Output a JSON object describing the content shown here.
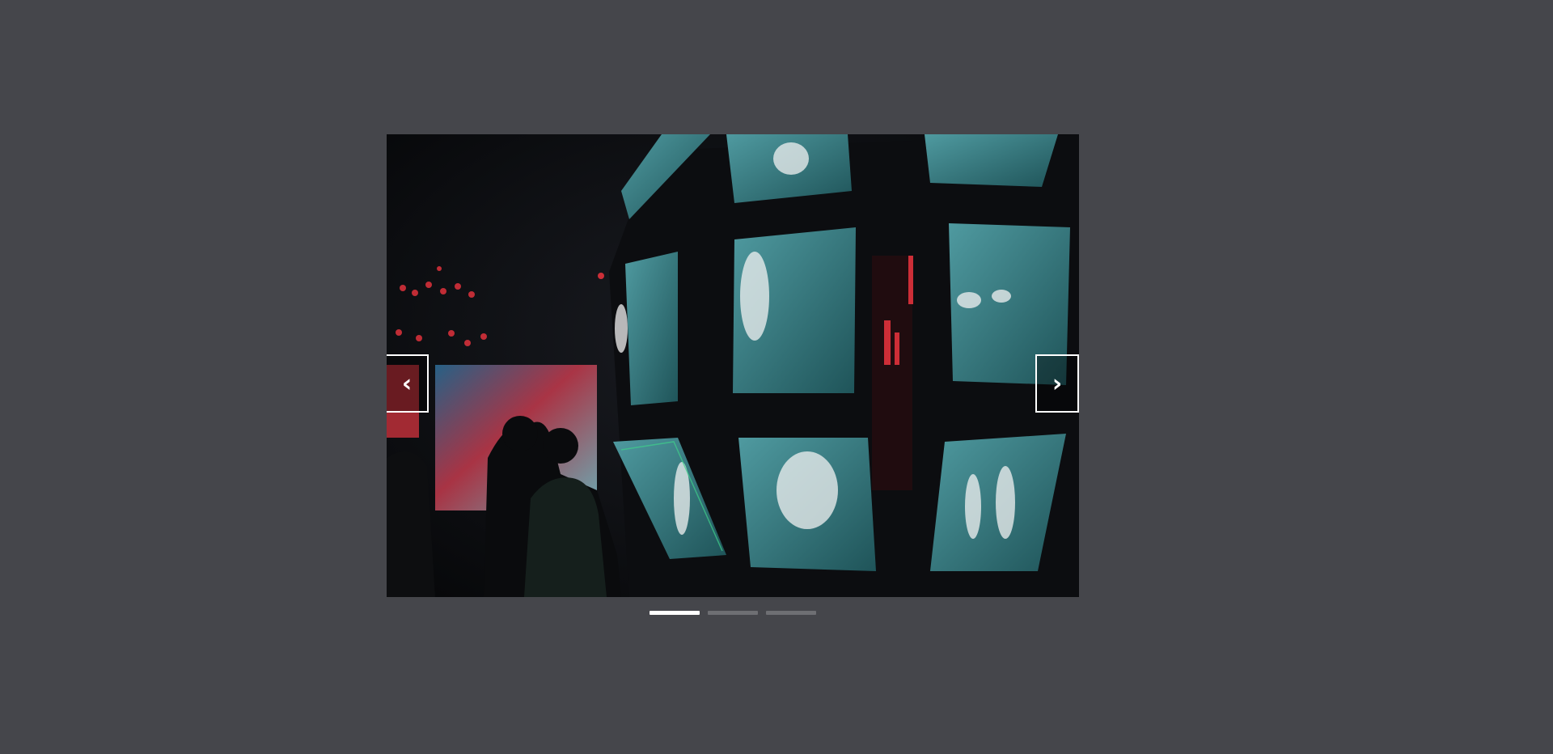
{
  "carousel": {
    "prev_icon": "chevron-left-icon",
    "next_icon": "chevron-right-icon",
    "prev_glyph": "‹",
    "next_glyph": "›",
    "slide_count": 3,
    "active_slide": 1,
    "image_subject": "video-monitor-installation-photo"
  },
  "colors": {
    "page_background": "#45464b",
    "indicator_active": "#ffffff",
    "indicator_inactive": "#6e6f73",
    "screen_teal": "#3a7a80",
    "accent_red": "#d0303a"
  }
}
